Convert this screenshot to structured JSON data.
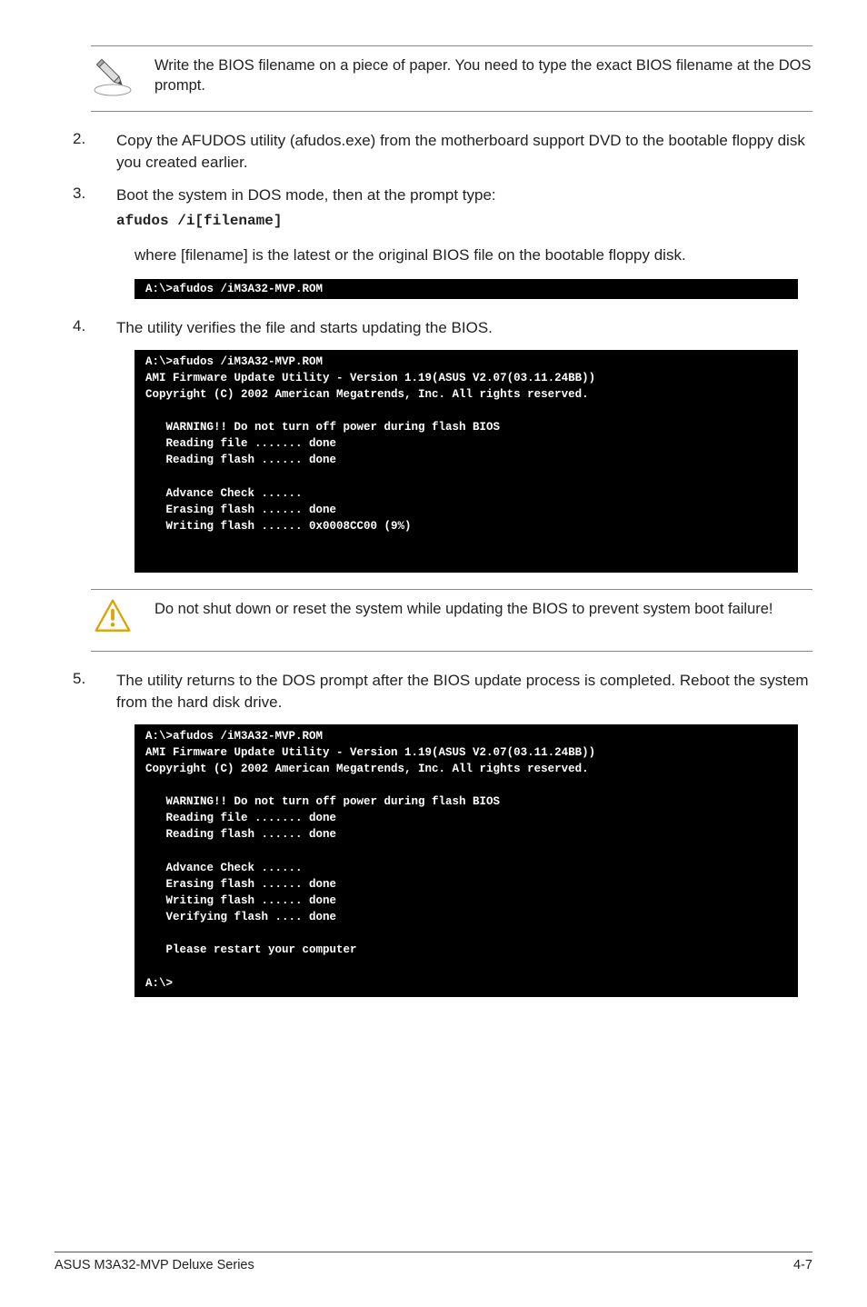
{
  "note1": "Write the BIOS filename on a piece of paper. You need to type the exact BIOS filename at the DOS prompt.",
  "step2": "Copy the AFUDOS utility (afudos.exe) from the motherboard support DVD to the bootable floppy disk you created earlier.",
  "step3": "Boot the system in DOS mode, then at the prompt type:",
  "step3_cmd": "afudos /i[filename]",
  "step3_desc": "where [filename] is the latest or the original BIOS file on the bootable floppy disk.",
  "term1": "A:\\>afudos /iM3A32-MVP.ROM",
  "step4": "The utility verifies the file and starts updating the BIOS.",
  "term2": "A:\\>afudos /iM3A32-MVP.ROM\nAMI Firmware Update Utility - Version 1.19(ASUS V2.07(03.11.24BB))\nCopyright (C) 2002 American Megatrends, Inc. All rights reserved.\n\n   WARNING!! Do not turn off power during flash BIOS\n   Reading file ....... done\n   Reading flash ...... done\n\n   Advance Check ......\n   Erasing flash ...... done\n   Writing flash ...... 0x0008CC00 (9%)\n\n\n",
  "warn1": "Do not shut down or reset the system while updating the BIOS to prevent system boot failure!",
  "step5": "The utility returns to the DOS prompt after the BIOS update process is completed. Reboot the system from the hard disk drive.",
  "term3": "A:\\>afudos /iM3A32-MVP.ROM\nAMI Firmware Update Utility - Version 1.19(ASUS V2.07(03.11.24BB))\nCopyright (C) 2002 American Megatrends, Inc. All rights reserved.\n\n   WARNING!! Do not turn off power during flash BIOS\n   Reading file ....... done\n   Reading flash ...... done\n\n   Advance Check ......\n   Erasing flash ...... done\n   Writing flash ...... done\n   Verifying flash .... done\n\n   Please restart your computer\n\nA:\\>",
  "footer_left": "ASUS M3A32-MVP Deluxe Series",
  "footer_right": "4-7",
  "nums": {
    "n2": "2.",
    "n3": "3.",
    "n4": "4.",
    "n5": "5."
  }
}
